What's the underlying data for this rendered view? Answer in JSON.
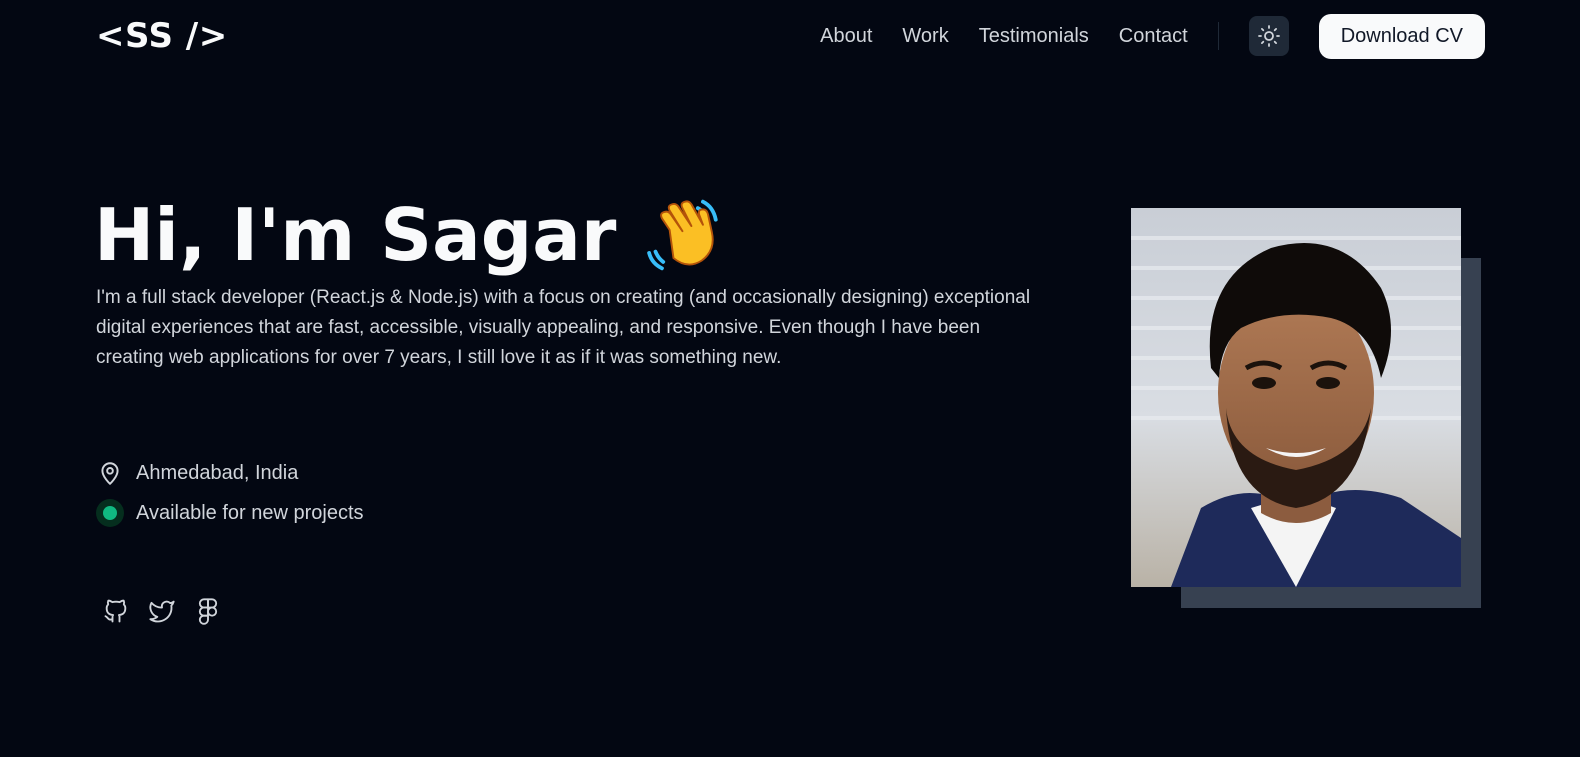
{
  "header": {
    "logo": "<SS />",
    "nav": [
      "About",
      "Work",
      "Testimonials",
      "Contact"
    ],
    "download_cv": "Download CV",
    "theme_icon": "sun-icon"
  },
  "hero": {
    "title": "Hi, I'm Sagar",
    "emoji": "👋",
    "description": "I'm a full stack developer (React.js & Node.js) with a focus on creating (and occasionally designing) exceptional digital experiences that are fast, accessible, visually appealing, and responsive. Even though I have been creating web applications for over 7 years, I still love it as if it was something new.",
    "location": "Ahmedabad, India",
    "status": "Available for new projects"
  },
  "socials": [
    "github-icon",
    "twitter-icon",
    "figma-icon"
  ],
  "colors": {
    "background": "#030712",
    "text": "#f9fafb",
    "muted": "#d1d5db",
    "status_green": "#10b981",
    "frame": "#374151"
  }
}
